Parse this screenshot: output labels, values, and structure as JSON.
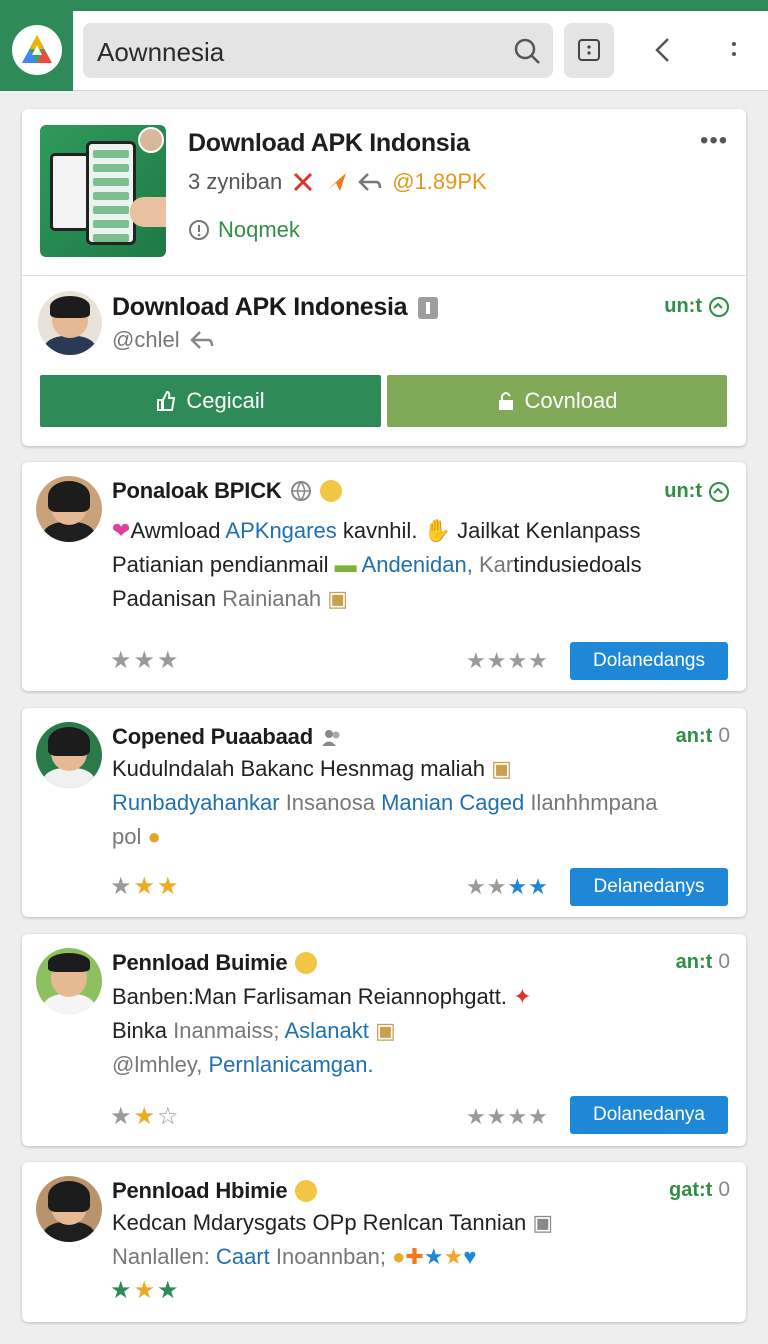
{
  "colors": {
    "brand": "#2e8b57",
    "download": "#80aa57",
    "action_blue": "#1e88d6",
    "link_blue": "#1f6fb2",
    "rating": "#e09a1a"
  },
  "header": {
    "search_value": "Aownnesia"
  },
  "app": {
    "title": "Download APK Indonsia",
    "meta_count": "3 zyniban",
    "rating": "@1.89PK",
    "status": "Noqmek",
    "developer": "Download APK Indonesia",
    "handle": "@chlel",
    "tag": "un:t",
    "button_primary": "Cegicail",
    "button_secondary": "Covnload"
  },
  "reviews": [
    {
      "name": "Ponaloak BPICK",
      "tag": "un:t",
      "line1a": "Awmload ",
      "line1b": "APKngares",
      "line1c": " kavnhil.",
      "line1d": " Jailkat Kenlanpass",
      "line2a": "Patianian pendianmail",
      "line2b": "Andenidan,",
      "line2c": " Kar",
      "line2d": "tindusiedoals",
      "line3a": "Padanisan ",
      "line3b": "Rainianah",
      "button": "Dolanedangs",
      "stars_left_count": 3,
      "stars_right_count": 4
    },
    {
      "name": "Copened Puaabaad",
      "tag": "an:t",
      "tag_num": "0",
      "line1a": "Kudulndalah Bakanc Hesnmag maliah",
      "line2a": "Runbadyahankar",
      "line2b": " Insanosa ",
      "line2c": "Manian Caged",
      "line2d": " Ilanhhmpana",
      "line3a": "pol",
      "button": "Delanedanys"
    },
    {
      "name": "Pennload Buimie",
      "tag": "an:t",
      "tag_num": "0",
      "line1a": "Banben:Man Farlisaman Reiannophgatt.",
      "line2a": "Binka ",
      "line2b": "Inanmaiss;",
      "line2c": " Aslanakt",
      "line3a": "@lmhley, ",
      "line3b": "Pernlanicamgan.",
      "button": "Dolanedanya"
    },
    {
      "name": "Pennload Hbimie",
      "tag": "gat:t",
      "tag_num": "0",
      "line1a": "Kedcan Mdarysgats OPp Renlcan Tannian",
      "line2a": "Nanlallen: ",
      "line2b": "Caart",
      "line2c": " Inoannban;"
    }
  ]
}
